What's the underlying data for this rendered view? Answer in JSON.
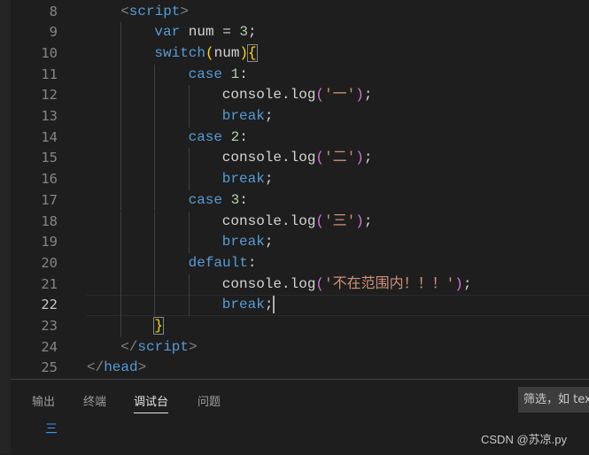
{
  "editor": {
    "current_line": 22,
    "lines": [
      {
        "n": "8",
        "indent": 1,
        "tokens": [
          [
            "tag",
            "<"
          ],
          [
            "tn",
            "script"
          ],
          [
            "tag",
            ">"
          ]
        ]
      },
      {
        "n": "9",
        "indent": 2,
        "tokens": [
          [
            "kw",
            "var"
          ],
          [
            "txt",
            " num = "
          ],
          [
            "num",
            "3"
          ],
          [
            "txt",
            ";"
          ]
        ]
      },
      {
        "n": "10",
        "indent": 2,
        "tokens": [
          [
            "kw",
            "switch"
          ],
          [
            "b1",
            "("
          ],
          [
            "txt",
            "num"
          ],
          [
            "b1",
            ")"
          ],
          [
            "b1m",
            "{"
          ]
        ]
      },
      {
        "n": "11",
        "indent": 3,
        "tokens": [
          [
            "kw",
            "case"
          ],
          [
            "txt",
            " "
          ],
          [
            "num",
            "1"
          ],
          [
            "txt",
            ":"
          ]
        ]
      },
      {
        "n": "12",
        "indent": 4,
        "tokens": [
          [
            "fn",
            "console.log"
          ],
          [
            "b2",
            "("
          ],
          [
            "str",
            "'一'"
          ],
          [
            "b2",
            ")"
          ],
          [
            "txt",
            ";"
          ]
        ]
      },
      {
        "n": "13",
        "indent": 4,
        "tokens": [
          [
            "kw",
            "break"
          ],
          [
            "txt",
            ";"
          ]
        ]
      },
      {
        "n": "14",
        "indent": 3,
        "tokens": [
          [
            "kw",
            "case"
          ],
          [
            "txt",
            " "
          ],
          [
            "num",
            "2"
          ],
          [
            "txt",
            ":"
          ]
        ]
      },
      {
        "n": "15",
        "indent": 4,
        "tokens": [
          [
            "fn",
            "console.log"
          ],
          [
            "b2",
            "("
          ],
          [
            "str",
            "'二'"
          ],
          [
            "b2",
            ")"
          ],
          [
            "txt",
            ";"
          ]
        ]
      },
      {
        "n": "16",
        "indent": 4,
        "tokens": [
          [
            "kw",
            "break"
          ],
          [
            "txt",
            ";"
          ]
        ]
      },
      {
        "n": "17",
        "indent": 3,
        "tokens": [
          [
            "kw",
            "case"
          ],
          [
            "txt",
            " "
          ],
          [
            "num",
            "3"
          ],
          [
            "txt",
            ":"
          ]
        ]
      },
      {
        "n": "18",
        "indent": 4,
        "tokens": [
          [
            "fn",
            "console.log"
          ],
          [
            "b2",
            "("
          ],
          [
            "str",
            "'三'"
          ],
          [
            "b2",
            ")"
          ],
          [
            "txt",
            ";"
          ]
        ]
      },
      {
        "n": "19",
        "indent": 4,
        "tokens": [
          [
            "kw",
            "break"
          ],
          [
            "txt",
            ";"
          ]
        ]
      },
      {
        "n": "20",
        "indent": 3,
        "tokens": [
          [
            "kw",
            "default"
          ],
          [
            "txt",
            ":"
          ]
        ]
      },
      {
        "n": "21",
        "indent": 4,
        "tokens": [
          [
            "fn",
            "console.log"
          ],
          [
            "b2",
            "("
          ],
          [
            "str",
            "'不在范围内！！！'"
          ],
          [
            "b2",
            ")"
          ],
          [
            "txt",
            ";"
          ]
        ]
      },
      {
        "n": "22",
        "indent": 4,
        "tokens": [
          [
            "kw",
            "break"
          ],
          [
            "txt",
            ";"
          ]
        ]
      },
      {
        "n": "23",
        "indent": 2,
        "tokens": [
          [
            "b1m",
            "}"
          ]
        ]
      },
      {
        "n": "24",
        "indent": 1,
        "tokens": [
          [
            "tag",
            "</"
          ],
          [
            "tn",
            "script"
          ],
          [
            "tag",
            ">"
          ]
        ]
      },
      {
        "n": "25",
        "indent": 0,
        "tokens": [
          [
            "tag",
            "</"
          ],
          [
            "tn",
            "head"
          ],
          [
            "tag",
            ">"
          ]
        ]
      }
    ]
  },
  "panel": {
    "tabs": [
      {
        "label": "输出",
        "active": false
      },
      {
        "label": "终端",
        "active": false
      },
      {
        "label": "调试台",
        "active": true
      },
      {
        "label": "问题",
        "active": false
      }
    ],
    "filter_placeholder": "筛选，如 text",
    "output": "三"
  },
  "watermark": "CSDN @苏凉.py"
}
